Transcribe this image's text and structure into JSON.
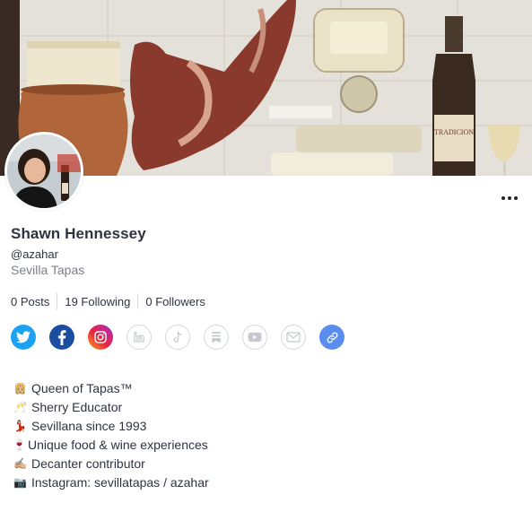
{
  "profile": {
    "name": "Shawn Hennessey",
    "handle": "@azahar",
    "location": "Sevilla Tapas"
  },
  "stats": [
    {
      "label": "0 Posts"
    },
    {
      "label": "19 Following"
    },
    {
      "label": "0 Followers"
    }
  ],
  "socials": [
    {
      "icon": "twitter-icon",
      "color": "#1da1f2"
    },
    {
      "icon": "facebook-icon",
      "color": "#1877f2"
    },
    {
      "icon": "instagram-icon",
      "color": "#d6249f"
    },
    {
      "icon": "linkedin-icon",
      "color": "#c5c9cf"
    },
    {
      "icon": "tiktok-icon",
      "color": "#c5c9cf"
    },
    {
      "icon": "substack-icon",
      "color": "#c5c9cf"
    },
    {
      "icon": "youtube-icon",
      "color": "#c5c9cf"
    },
    {
      "icon": "email-icon",
      "color": "#c5c9cf"
    },
    {
      "icon": "link-icon",
      "color": "#5b8def"
    }
  ],
  "bio": [
    {
      "emoji": "👸🏼",
      "text": "Queen of Tapas™"
    },
    {
      "emoji": "🥂",
      "text": "Sherry Educator"
    },
    {
      "emoji": "💃🏻",
      "text": "Sevillana since 1993"
    },
    {
      "emoji": "🍷",
      "text": "Unique food & wine experiences"
    },
    {
      "emoji": "✍🏼",
      "text": "Decanter contributor"
    },
    {
      "emoji": "📷",
      "text": "Instagram: sevillatapas / azahar"
    }
  ],
  "cover": {
    "bottle_label": "TRADICION"
  }
}
